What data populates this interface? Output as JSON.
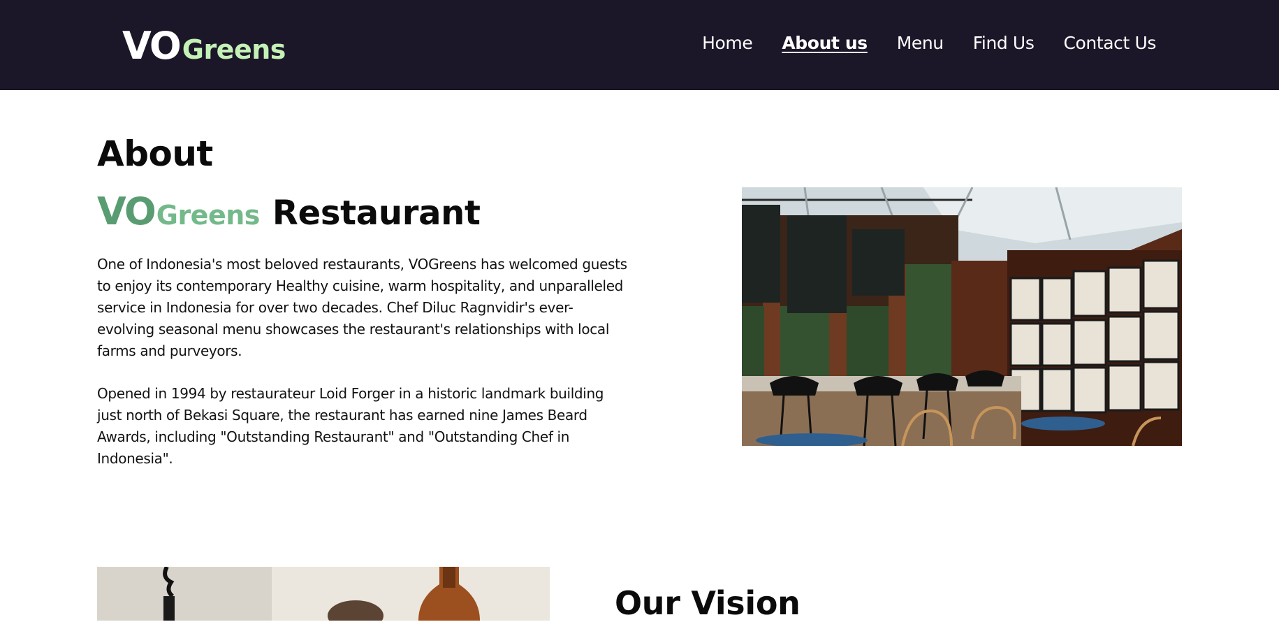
{
  "brand": {
    "logo_vo": "VO",
    "logo_greens": "Greens"
  },
  "nav": {
    "items": [
      {
        "label": "Home",
        "active": false
      },
      {
        "label": "About us",
        "active": true
      },
      {
        "label": "Menu",
        "active": false
      },
      {
        "label": "Find Us",
        "active": false
      },
      {
        "label": "Contact Us",
        "active": false
      }
    ]
  },
  "about": {
    "title": "About",
    "brand_vo": "VO",
    "brand_greens": "Greens",
    "subtitle": "Restaurant",
    "paragraph1": "One of Indonesia's most beloved restaurants, VOGreens has welcomed guests to enjoy its contemporary Healthy cuisine, warm hospitality, and unparalleled service in Indonesia for over two decades. Chef Diluc Ragnvidir's ever-evolving seasonal menu showcases the restaurant's relationships with local farms and purveyors.",
    "paragraph2": "Opened in 1994 by restaurateur Loid Forger in a historic landmark building just north of Bekasi Square, the restaurant has earned nine James Beard Awards, including \"Outstanding Restaurant\" and \"Outstanding Chef in Indonesia\"."
  },
  "vision": {
    "title": "Our Vision"
  },
  "colors": {
    "nav_bg": "#1c1629",
    "logo_greens": "#c4f2b6",
    "brand_vo_green": "#5a9c72",
    "brand_greens_green": "#73b98a"
  }
}
